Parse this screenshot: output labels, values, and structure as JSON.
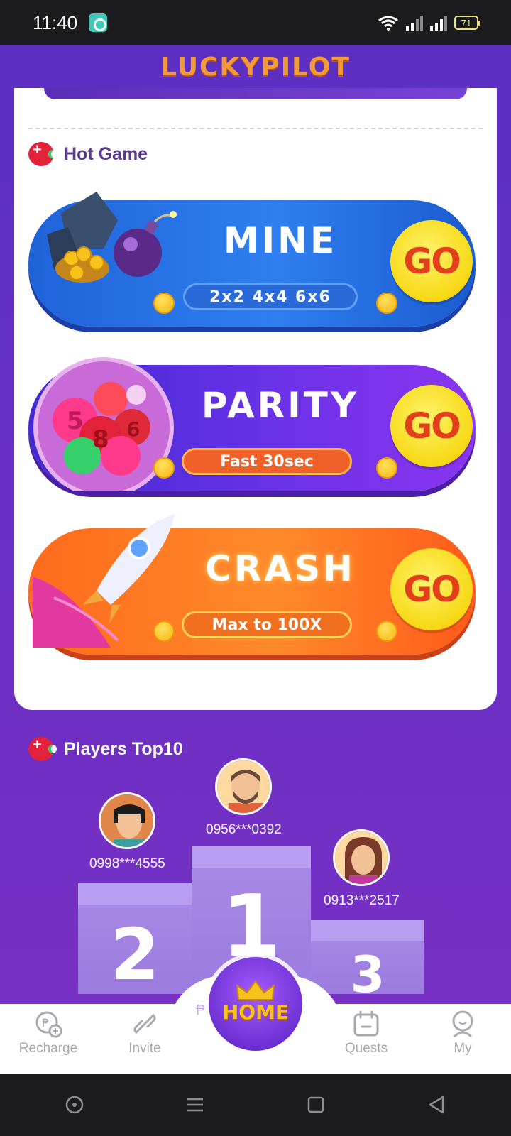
{
  "status_bar": {
    "time": "11:40",
    "battery": "71"
  },
  "header": {
    "logo": "LUCKYPILOT"
  },
  "hot_game": {
    "title": "Hot Game",
    "games": [
      {
        "title": "MINE",
        "subtitle": "2x2  4x4  6x6",
        "go": "GO"
      },
      {
        "title": "PARITY",
        "subtitle": "Fast 30sec",
        "go": "GO"
      },
      {
        "title": "CRASH",
        "subtitle": "Max to 100X",
        "go": "GO"
      }
    ]
  },
  "players": {
    "title": "Players Top10",
    "podium": [
      {
        "rank": "1",
        "phone": "0956***0392"
      },
      {
        "rank": "2",
        "phone": "0998***4555"
      },
      {
        "rank": "3",
        "phone": "0913***2517"
      }
    ]
  },
  "bottom_nav": {
    "items": [
      "Recharge",
      "Invite",
      "Quests",
      "My"
    ],
    "home": "HOME",
    "currency_symbol": "₱"
  },
  "icons": {
    "status": [
      "app-icon",
      "wifi-icon",
      "signal-icon",
      "battery-icon"
    ],
    "section": "gamepad-icon",
    "nav": [
      "recharge-icon",
      "invite-icon",
      "crown-icon",
      "quests-icon",
      "my-icon"
    ],
    "android_nav": [
      "circle-icon",
      "menu-icon",
      "square-icon",
      "back-icon"
    ]
  },
  "colors": {
    "background": "#6a2fc4",
    "logo": "#f39a3b",
    "hot_title": "#5a3a8a",
    "mine_banner": "#2f7ff0",
    "parity_banner": "#6a32e6",
    "crash_banner": "#ff8a2a",
    "go_text": "#e2401a"
  }
}
